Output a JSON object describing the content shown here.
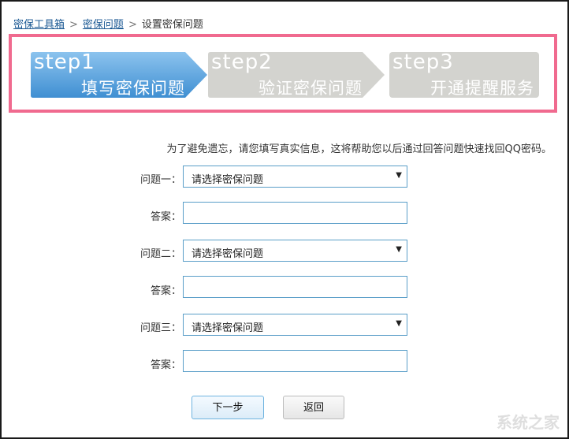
{
  "breadcrumb": [
    "密保工具箱",
    "密保问题",
    "设置密保问题"
  ],
  "steps": [
    {
      "num": "step1",
      "title": "填写密保问题",
      "color": "#5ca8e0",
      "active": true
    },
    {
      "num": "step2",
      "title": "验证密保问题",
      "color": "#d3d3cf"
    },
    {
      "num": "step3",
      "title": "开通提醒服务",
      "color": "#d3d3cf"
    }
  ],
  "info": "为了避免遗忘，请您填写真实信息，这将帮助您以后通过回答问题快速找回QQ密码。",
  "form": {
    "q1_label": "问题一：",
    "q2_label": "问题二：",
    "q3_label": "问题三：",
    "answer_label": "答案：",
    "select_value": "请选择密保问题",
    "answer1": "",
    "answer2": "",
    "answer3": ""
  },
  "buttons": {
    "next": "下一步",
    "back": "返回"
  },
  "watermark": "系统之家"
}
